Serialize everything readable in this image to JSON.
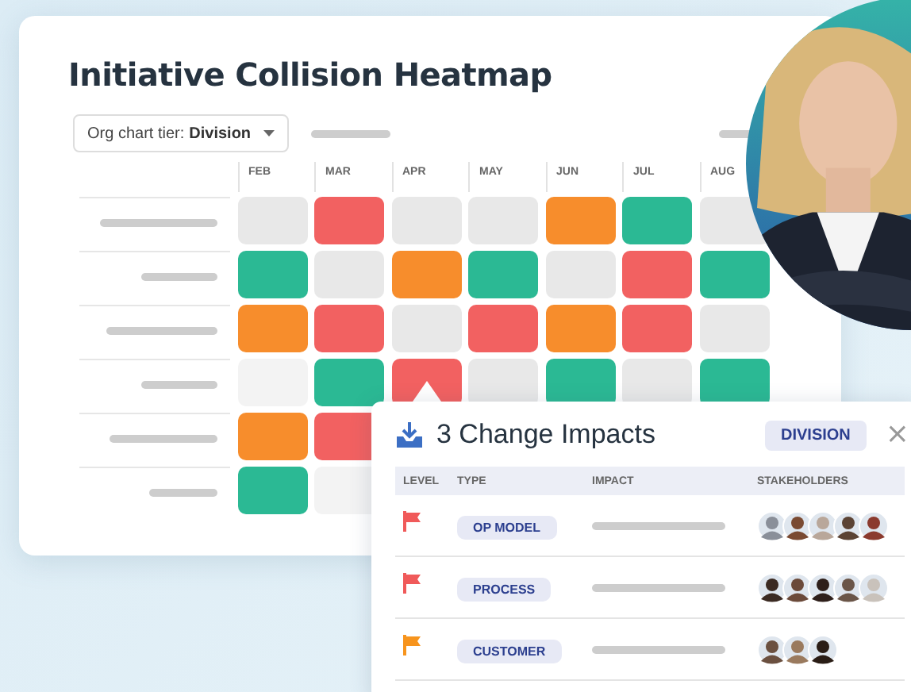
{
  "heatmap": {
    "title": "Initiative Collision Heatmap",
    "dropdown": {
      "label": "Org chart tier:",
      "value": "Division"
    },
    "months": [
      "FEB",
      "MAR",
      "APR",
      "MAY",
      "JUN",
      "JUL",
      "AUG"
    ],
    "rows": [
      {
        "cells": [
          {
            "color": "#e8e8e8"
          },
          {
            "color": "#f26161"
          },
          {
            "color": "#e8e8e8"
          },
          {
            "color": "#e8e8e8"
          },
          {
            "color": "#f78d2c"
          },
          {
            "color": "#2bb994"
          },
          {
            "color": "#e8e8e8"
          }
        ]
      },
      {
        "cells": [
          {
            "color": "#2bb994"
          },
          {
            "color": "#e8e8e8"
          },
          {
            "color": "#f78d2c"
          },
          {
            "color": "#2bb994"
          },
          {
            "color": "#e8e8e8"
          },
          {
            "color": "#f26161"
          },
          {
            "color": "#2bb994"
          }
        ]
      },
      {
        "cells": [
          {
            "color": "#f78d2c"
          },
          {
            "color": "#f26161"
          },
          {
            "color": "#e8e8e8"
          },
          {
            "color": "#f26161"
          },
          {
            "color": "#f78d2c"
          },
          {
            "color": "#f26161"
          },
          {
            "color": "#e8e8e8"
          }
        ]
      },
      {
        "cells": [
          {
            "color": "#f3f3f3"
          },
          {
            "color": "#2bb994"
          },
          {
            "color": "#f26161"
          },
          {
            "color": "#e8e8e8"
          },
          {
            "color": "#2bb994"
          },
          {
            "color": "#e8e8e8"
          },
          {
            "color": "#2bb994"
          }
        ]
      },
      {
        "cells": [
          {
            "color": "#f78d2c"
          },
          {
            "color": "#f26161"
          }
        ]
      },
      {
        "cells": [
          {
            "color": "#2bb994"
          },
          {
            "color": "#f3f3f3"
          }
        ]
      }
    ]
  },
  "popup": {
    "title": "3 Change Impacts",
    "badge": "DIVISION",
    "close": "×",
    "columns": [
      "LEVEL",
      "TYPE",
      "IMPACT",
      "STAKEHOLDERS"
    ],
    "rows": [
      {
        "color": "#f05a5a",
        "type": "OP MODEL",
        "stakeholders": [
          {
            "color": "#8a8f99"
          },
          {
            "color": "#7a4a32"
          },
          {
            "color": "#b9a79a"
          },
          {
            "color": "#5b4334"
          },
          {
            "color": "#8b3a2e"
          }
        ]
      },
      {
        "color": "#f05a5a",
        "type": "PROCESS",
        "stakeholders": [
          {
            "color": "#3b2a22"
          },
          {
            "color": "#6b4a3a"
          },
          {
            "color": "#2e1f1a"
          },
          {
            "color": "#6a5548"
          },
          {
            "color": "#c9c2bb"
          }
        ]
      },
      {
        "color": "#f7941d",
        "type": "CUSTOMER",
        "stakeholders": [
          {
            "color": "#6b5040"
          },
          {
            "color": "#9a7a5e"
          },
          {
            "color": "#2a1d16"
          }
        ]
      }
    ]
  }
}
